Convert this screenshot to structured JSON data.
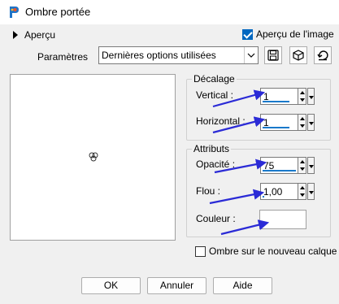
{
  "window": {
    "title": "Ombre portée"
  },
  "apercu": {
    "label": "Aperçu",
    "check_label": "Aperçu de l'image",
    "checked": true
  },
  "params": {
    "label": "Paramètres",
    "preset_value": "Dernières options utilisées"
  },
  "offset_group": {
    "title": "Décalage",
    "vertical_label": "Vertical :",
    "vertical_value": "1",
    "horizontal_label": "Horizontal :",
    "horizontal_value": "1"
  },
  "attributes_group": {
    "title": "Attributs",
    "opacity_label": "Opacité :",
    "opacity_value": "75",
    "blur_label": "Flou :",
    "blur_value": "1,00",
    "color_label": "Couleur :",
    "color_value": "#ffffff"
  },
  "new_layer": {
    "label": "Ombre sur le nouveau calque",
    "checked": false
  },
  "buttons": {
    "ok": "OK",
    "cancel": "Annuler",
    "help": "Aide"
  },
  "colors": {
    "accent": "#0067c0",
    "annotation_arrow": "#2b2bd6"
  }
}
